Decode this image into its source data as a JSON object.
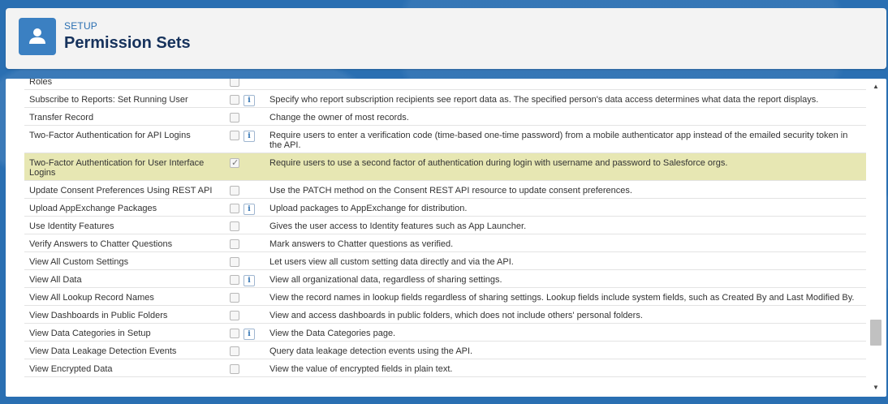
{
  "header": {
    "eyebrow": "SETUP",
    "title": "Permission Sets",
    "icon": "user-icon"
  },
  "permissions": [
    {
      "name": "Roles",
      "checked": false,
      "info": false,
      "description": ""
    },
    {
      "name": "Subscribe to Reports: Set Running User",
      "checked": false,
      "info": true,
      "description": "Specify who report subscription recipients see report data as. The specified person's data access determines what data the report displays."
    },
    {
      "name": "Transfer Record",
      "checked": false,
      "info": false,
      "description": "Change the owner of most records."
    },
    {
      "name": "Two-Factor Authentication for API Logins",
      "checked": false,
      "info": true,
      "description": "Require users to enter a verification code (time-based one-time password) from a mobile authenticator app instead of the emailed security token in the API."
    },
    {
      "name": "Two-Factor Authentication for User Interface Logins",
      "checked": true,
      "info": false,
      "highlight": true,
      "description": "Require users to use a second factor of authentication during login with username and password to Salesforce orgs."
    },
    {
      "name": "Update Consent Preferences Using REST API",
      "checked": false,
      "info": false,
      "description": "Use the PATCH method on the Consent REST API resource to update consent preferences."
    },
    {
      "name": "Upload AppExchange Packages",
      "checked": false,
      "info": true,
      "description": "Upload packages to AppExchange for distribution."
    },
    {
      "name": "Use Identity Features",
      "checked": false,
      "info": false,
      "description": "Gives the user access to Identity features such as App Launcher."
    },
    {
      "name": "Verify Answers to Chatter Questions",
      "checked": false,
      "info": false,
      "description": "Mark answers to Chatter questions as verified."
    },
    {
      "name": "View All Custom Settings",
      "checked": false,
      "info": false,
      "description": "Let users view all custom setting data directly and via the API."
    },
    {
      "name": "View All Data",
      "checked": false,
      "info": true,
      "description": "View all organizational data, regardless of sharing settings."
    },
    {
      "name": "View All Lookup Record Names",
      "checked": false,
      "info": false,
      "description": "View the record names in lookup fields regardless of sharing settings. Lookup fields include system fields, such as Created By and Last Modified By."
    },
    {
      "name": "View Dashboards in Public Folders",
      "checked": false,
      "info": false,
      "description": "View and access dashboards in public folders, which does not include others' personal folders."
    },
    {
      "name": "View Data Categories in Setup",
      "checked": false,
      "info": true,
      "description": "View the Data Categories page."
    },
    {
      "name": "View Data Leakage Detection Events",
      "checked": false,
      "info": false,
      "description": "Query data leakage detection events using the API."
    },
    {
      "name": "View Encrypted Data",
      "checked": false,
      "info": false,
      "description": "View the value of encrypted fields in plain text."
    }
  ],
  "scrollbar": {
    "up": "▲",
    "down": "▼"
  }
}
